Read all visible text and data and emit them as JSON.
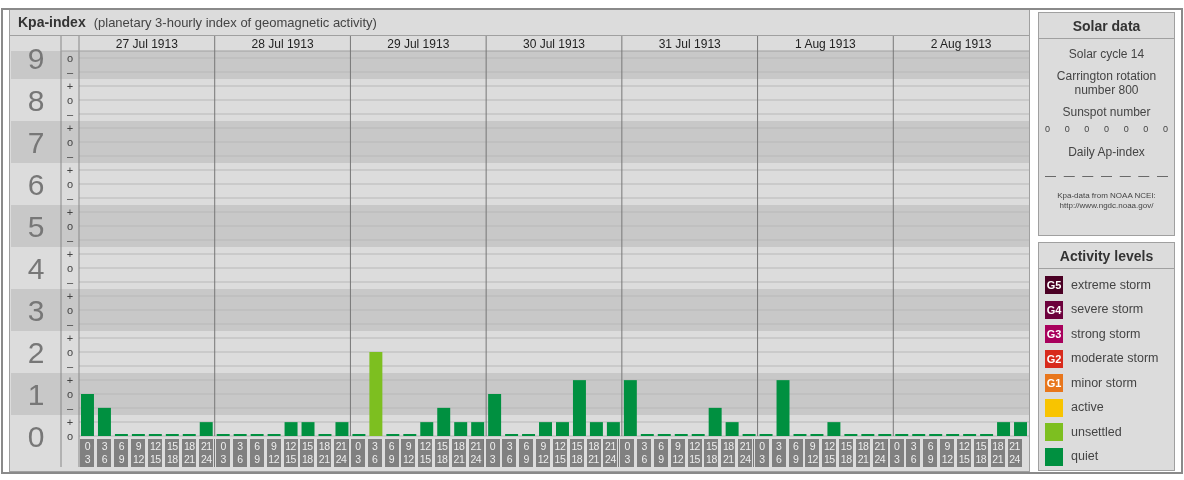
{
  "header": {
    "title": "Kpa-index",
    "subtitle": "(planetary 3-hourly index of geomagnetic activity)"
  },
  "days": [
    {
      "date": "27 Jul 1913",
      "slots": [
        {
          "from": "0",
          "to": "3"
        },
        {
          "from": "3",
          "to": "6"
        },
        {
          "from": "6",
          "to": "9"
        },
        {
          "from": "9",
          "to": "12"
        },
        {
          "from": "12",
          "to": "15"
        },
        {
          "from": "15",
          "to": "18"
        },
        {
          "from": "18",
          "to": "21"
        },
        {
          "from": "21",
          "to": "24"
        }
      ]
    },
    {
      "date": "28 Jul 1913",
      "slots": [
        {
          "from": "0",
          "to": "3"
        },
        {
          "from": "3",
          "to": "6"
        },
        {
          "from": "6",
          "to": "9"
        },
        {
          "from": "9",
          "to": "12"
        },
        {
          "from": "12",
          "to": "15"
        },
        {
          "from": "15",
          "to": "18"
        },
        {
          "from": "18",
          "to": "21"
        },
        {
          "from": "21",
          "to": "24"
        }
      ]
    },
    {
      "date": "29 Jul 1913",
      "slots": [
        {
          "from": "0",
          "to": "3"
        },
        {
          "from": "3",
          "to": "6"
        },
        {
          "from": "6",
          "to": "9"
        },
        {
          "from": "9",
          "to": "12"
        },
        {
          "from": "12",
          "to": "15"
        },
        {
          "from": "15",
          "to": "18"
        },
        {
          "from": "18",
          "to": "21"
        },
        {
          "from": "21",
          "to": "24"
        }
      ]
    },
    {
      "date": "30 Jul 1913",
      "slots": [
        {
          "from": "0",
          "to": "3"
        },
        {
          "from": "3",
          "to": "6"
        },
        {
          "from": "6",
          "to": "9"
        },
        {
          "from": "9",
          "to": "12"
        },
        {
          "from": "12",
          "to": "15"
        },
        {
          "from": "15",
          "to": "18"
        },
        {
          "from": "18",
          "to": "21"
        },
        {
          "from": "21",
          "to": "24"
        }
      ]
    },
    {
      "date": "31 Jul 1913",
      "slots": [
        {
          "from": "0",
          "to": "3"
        },
        {
          "from": "3",
          "to": "6"
        },
        {
          "from": "6",
          "to": "9"
        },
        {
          "from": "9",
          "to": "12"
        },
        {
          "from": "12",
          "to": "15"
        },
        {
          "from": "15",
          "to": "18"
        },
        {
          "from": "18",
          "to": "21"
        },
        {
          "from": "21",
          "to": "24"
        }
      ]
    },
    {
      "date": "1 Aug 1913",
      "slots": [
        {
          "from": "0",
          "to": "3"
        },
        {
          "from": "3",
          "to": "6"
        },
        {
          "from": "6",
          "to": "9"
        },
        {
          "from": "9",
          "to": "12"
        },
        {
          "from": "12",
          "to": "15"
        },
        {
          "from": "15",
          "to": "18"
        },
        {
          "from": "18",
          "to": "21"
        },
        {
          "from": "21",
          "to": "24"
        }
      ]
    },
    {
      "date": "2 Aug 1913",
      "slots": [
        {
          "from": "0",
          "to": "3"
        },
        {
          "from": "3",
          "to": "6"
        },
        {
          "from": "6",
          "to": "9"
        },
        {
          "from": "9",
          "to": "12"
        },
        {
          "from": "12",
          "to": "15"
        },
        {
          "from": "15",
          "to": "18"
        },
        {
          "from": "18",
          "to": "21"
        },
        {
          "from": "21",
          "to": "24"
        }
      ]
    }
  ],
  "chart_data": {
    "type": "bar",
    "stacked": true,
    "grid": true,
    "ylim": [
      0,
      9
    ],
    "yticks": [
      {
        "value": 9,
        "label": "9"
      },
      {
        "value": 8,
        "label": "8"
      },
      {
        "value": 7,
        "label": "7"
      },
      {
        "value": 6,
        "label": "6"
      },
      {
        "value": 5,
        "label": "5"
      },
      {
        "value": 4,
        "label": "4"
      },
      {
        "value": 3,
        "label": "3"
      },
      {
        "value": 2,
        "label": "2"
      },
      {
        "value": 1,
        "label": "1"
      },
      {
        "value": 0,
        "label": "0"
      }
    ],
    "series": [
      {
        "color": "#009040",
        "values": [
          1,
          0.67,
          0,
          0,
          0,
          0,
          0,
          0.33,
          0,
          0,
          0,
          0,
          0.33,
          0.33,
          0,
          0.33,
          0,
          null,
          0,
          0,
          0.33,
          0.67,
          0.33,
          0.33,
          1,
          0,
          0,
          0.33,
          0.33,
          1.33,
          0.33,
          0.33,
          1.33,
          0,
          0,
          0,
          0,
          0.67,
          0.33,
          0,
          0,
          1.33,
          0,
          0,
          0.33,
          0,
          0,
          0,
          0,
          0,
          0,
          0,
          0,
          0,
          0.33,
          0.33
        ]
      },
      {
        "color": "#7dbf20",
        "values": [
          null,
          null,
          null,
          null,
          null,
          null,
          null,
          null,
          null,
          null,
          null,
          null,
          null,
          null,
          null,
          null,
          null,
          2,
          null,
          null,
          null,
          null,
          null,
          null,
          null,
          null,
          null,
          null,
          null,
          null,
          null,
          null,
          null,
          null,
          null,
          null,
          null,
          null,
          null,
          null,
          null,
          null,
          null,
          null,
          null,
          null,
          null,
          null,
          null,
          null,
          null,
          null,
          null,
          null,
          null,
          null
        ]
      }
    ]
  },
  "scale_marks": [
    [
      "o",
      "–"
    ],
    [
      "+",
      "o",
      "–"
    ],
    [
      "+",
      "o",
      "–"
    ],
    [
      "+",
      "o",
      "–"
    ],
    [
      "+",
      "o",
      "–"
    ],
    [
      "+",
      "o",
      "–"
    ],
    [
      "+",
      "o",
      "–"
    ],
    [
      "+",
      "o",
      "–"
    ],
    [
      "+",
      "o",
      "–"
    ],
    [
      "+",
      "o"
    ]
  ],
  "solar": {
    "title": "Solar data",
    "cycle": "Solar cycle 14",
    "rotation": "Carrington rotation number 800",
    "sunspot_title": "Sunspot number",
    "sunspots": [
      "0",
      "0",
      "0",
      "0",
      "0",
      "0",
      "0"
    ],
    "ap_title": "Daily Ap-index",
    "ap": [
      "—",
      "—",
      "—",
      "—",
      "—",
      "—",
      "—"
    ],
    "source": "Kpa-data from NOAA NCEI:",
    "source_url": "http://www.ngdc.noaa.gov/"
  },
  "legend": {
    "title": "Activity levels",
    "levels": [
      {
        "code": "G5",
        "label": "extreme storm",
        "color": "#4a0024"
      },
      {
        "code": "G4",
        "label": "severe storm",
        "color": "#6c003c"
      },
      {
        "code": "G3",
        "label": "strong storm",
        "color": "#a8005c"
      },
      {
        "code": "G2",
        "label": "moderate storm",
        "color": "#d82a1c"
      },
      {
        "code": "G1",
        "label": "minor storm",
        "color": "#e8761c"
      },
      {
        "label": "active",
        "color": "#f8c400"
      },
      {
        "label": "unsettled",
        "color": "#7dbf20"
      },
      {
        "label": "quiet",
        "color": "#009040"
      }
    ]
  }
}
